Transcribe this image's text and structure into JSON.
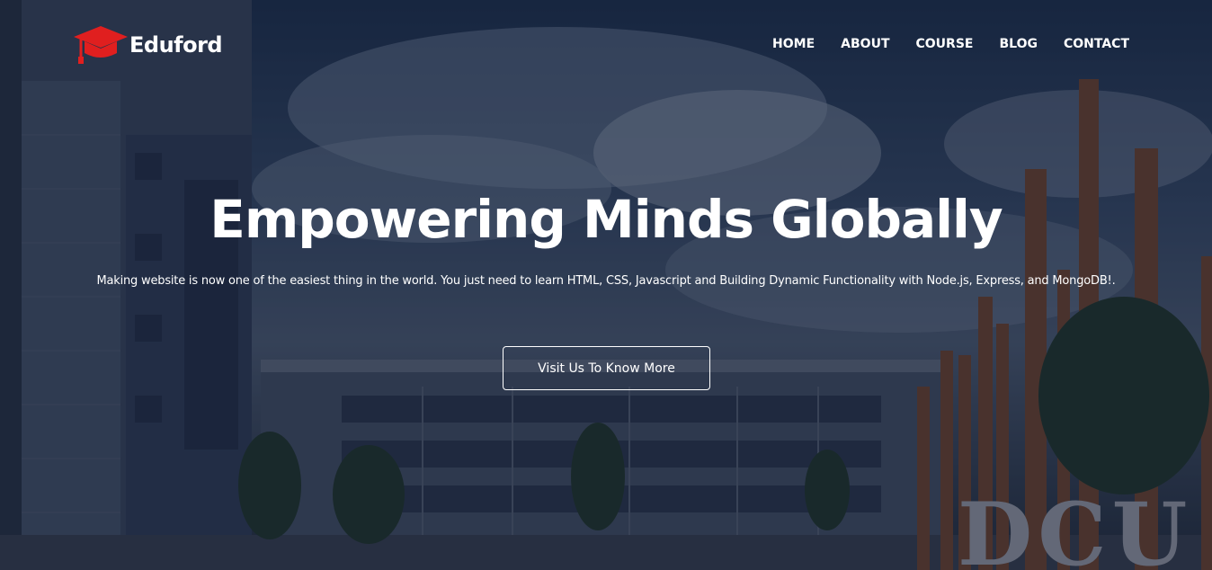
{
  "brand": {
    "name": "Eduford",
    "logo_icon": "graduation-cap-icon",
    "logo_color": "#e01f1f"
  },
  "nav": {
    "items": [
      "HOME",
      "ABOUT",
      "COURSE",
      "BLOG",
      "CONTACT"
    ]
  },
  "hero": {
    "title": "Empowering Minds Globally",
    "subtitle": "Making website is now one of the easiest thing in the world. You just need to learn HTML, CSS, Javascript and Building Dynamic Functionality with Node.js, Express, and MongoDB!.",
    "cta_label": "Visit Us To Know More",
    "background_sign_text": "DCU",
    "accent_text_color": "#ffffff"
  }
}
